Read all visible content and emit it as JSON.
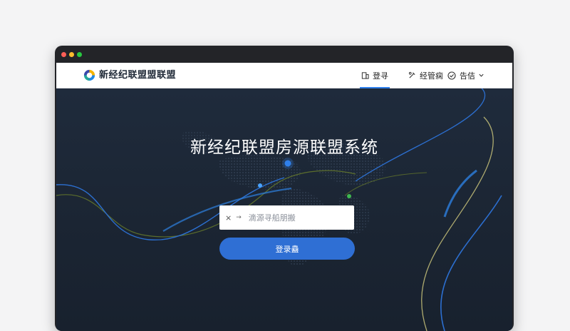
{
  "brand": {
    "name": "新经纪联盟盟联盟",
    "logo_icon": "logo-ring-icon"
  },
  "nav": {
    "items": [
      {
        "label": "登寻",
        "icon": "building-icon",
        "active": true
      },
      {
        "label": "经管痫",
        "icon": "tools-icon",
        "active": false
      },
      {
        "label": "告佶",
        "icon": "check-circle-icon",
        "dropdown": true,
        "active": false
      }
    ]
  },
  "hero": {
    "title": "新经纪联盟房源联盟系统",
    "search": {
      "placeholder": "滴源寻船朋搬",
      "prefix_icon": "crossed-x-icon",
      "arrow": "→"
    },
    "submit_label": "登录蠱"
  },
  "colors": {
    "accent": "#2f6fd4",
    "nav_underline": "#2f80ed",
    "hero_bg": "#1c2634"
  }
}
